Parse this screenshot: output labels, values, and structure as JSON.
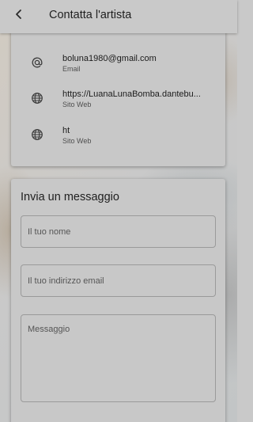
{
  "header": {
    "title": "Contatta l'artista",
    "back_icon": "chevron-left-icon"
  },
  "contacts": [
    {
      "icon": "at-sign-icon",
      "value": "boluna1980@gmail.com",
      "type": "Email"
    },
    {
      "icon": "globe-icon",
      "value": "https://LuanaLunaBomba.dantebu...",
      "type": "Sito Web"
    },
    {
      "icon": "globe-icon",
      "value": "ht",
      "type": "Sito Web"
    }
  ],
  "message_form": {
    "title": "Invia un messaggio",
    "name_placeholder": "Il tuo nome",
    "email_placeholder": "Il tuo indirizzo email",
    "message_placeholder": "Messaggio"
  }
}
